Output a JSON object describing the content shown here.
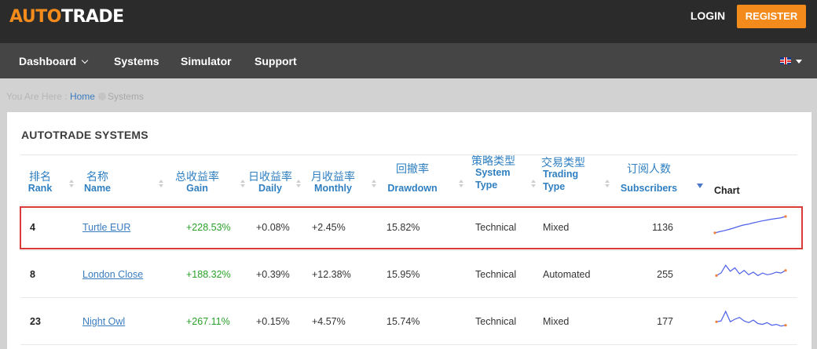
{
  "brand": {
    "part1": "AUTO",
    "part2": "TRADE"
  },
  "auth": {
    "login": "LOGIN",
    "register": "REGISTER"
  },
  "nav": {
    "dashboard": "Dashboard",
    "systems": "Systems",
    "simulator": "Simulator",
    "support": "Support"
  },
  "language": {
    "icon": "uk-flag-icon"
  },
  "breadcrumb": {
    "prefix": "You Are Here :",
    "home": "Home",
    "current": "Systems"
  },
  "panel": {
    "title": "AUTOTRADE SYSTEMS"
  },
  "columns": {
    "rank": {
      "zh": "排名",
      "en": "Rank"
    },
    "name": {
      "zh": "名称",
      "en": "Name"
    },
    "gain": {
      "zh": "总收益率",
      "en": "Gain"
    },
    "daily": {
      "zh": "日收益率",
      "en": "Daily"
    },
    "monthly": {
      "zh": "月收益率",
      "en": "Monthly"
    },
    "drawdown": {
      "zh": "回撤率",
      "en": "Drawdown"
    },
    "system_type": {
      "zh": "策略类型",
      "en1": "System",
      "en2": "Type"
    },
    "trading_type": {
      "zh": "交易类型",
      "en1": "Trading",
      "en2": "Type"
    },
    "subscribers": {
      "zh": "订阅人数",
      "en": "Subscribers"
    },
    "chart": {
      "en": "Chart"
    }
  },
  "rows": [
    {
      "rank": "4",
      "name": "Turtle EUR",
      "gain": "+228.53%",
      "daily": "+0.08%",
      "monthly": "+2.45%",
      "drawdown": "15.82%",
      "system_type": "Technical",
      "trading_type": "Mixed",
      "subscribers": "1136",
      "spark": [
        0.05,
        0.12,
        0.18,
        0.25,
        0.33,
        0.42,
        0.5,
        0.55,
        0.62,
        0.68,
        0.74,
        0.79,
        0.84,
        0.88,
        0.92,
        1.0
      ]
    },
    {
      "rank": "8",
      "name": "London Close",
      "gain": "+188.32%",
      "daily": "+0.39%",
      "monthly": "+12.38%",
      "drawdown": "15.95%",
      "system_type": "Technical",
      "trading_type": "Automated",
      "subscribers": "255",
      "spark": [
        0.3,
        0.45,
        0.9,
        0.55,
        0.75,
        0.4,
        0.6,
        0.35,
        0.5,
        0.3,
        0.45,
        0.35,
        0.4,
        0.5,
        0.45,
        0.6
      ]
    },
    {
      "rank": "23",
      "name": "Night Owl",
      "gain": "+267.11%",
      "daily": "+0.15%",
      "monthly": "+4.57%",
      "drawdown": "15.74%",
      "system_type": "Technical",
      "trading_type": "Mixed",
      "subscribers": "177",
      "spark": [
        0.35,
        0.4,
        0.95,
        0.35,
        0.5,
        0.6,
        0.4,
        0.3,
        0.45,
        0.25,
        0.2,
        0.3,
        0.15,
        0.2,
        0.1,
        0.15
      ]
    }
  ],
  "colors": {
    "accent": "#f38b1c",
    "link": "#3a7cc0",
    "gain": "#2aa02a",
    "highlight": "#d93a3a",
    "spark_line": "#4c5fe8",
    "spark_point": "#f0803a"
  }
}
